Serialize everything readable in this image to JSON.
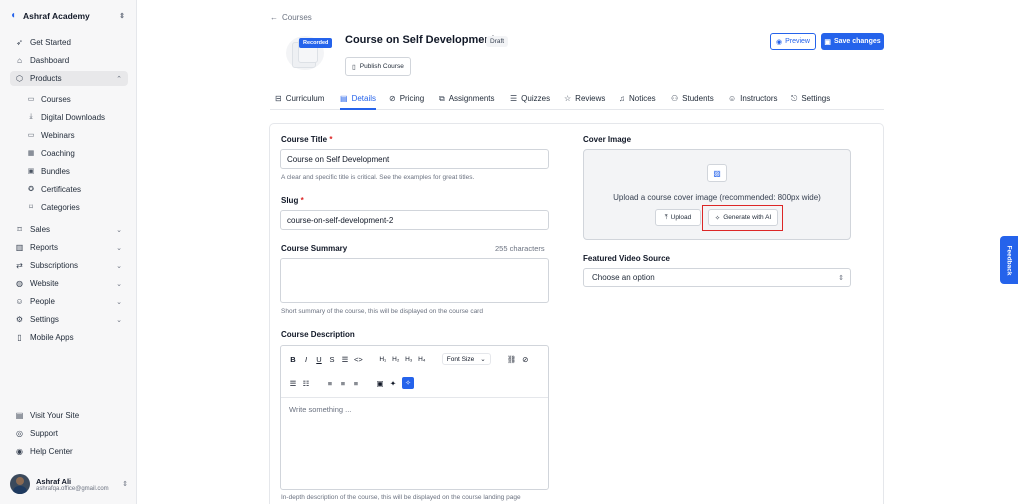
{
  "sidebar": {
    "org_name": "Ashraf Academy",
    "items": [
      {
        "label": "Get Started",
        "icon": "rocket-icon"
      },
      {
        "label": "Dashboard",
        "icon": "home-icon"
      },
      {
        "label": "Products",
        "icon": "box-icon"
      },
      {
        "label": "Sales",
        "icon": "tag-icon"
      },
      {
        "label": "Reports",
        "icon": "chart-icon"
      },
      {
        "label": "Subscriptions",
        "icon": "repeat-icon"
      },
      {
        "label": "Website",
        "icon": "globe-icon"
      },
      {
        "label": "People",
        "icon": "user-icon"
      },
      {
        "label": "Settings",
        "icon": "gear-icon"
      },
      {
        "label": "Mobile Apps",
        "icon": "phone-icon"
      }
    ],
    "product_subitems": [
      {
        "label": "Courses"
      },
      {
        "label": "Digital Downloads"
      },
      {
        "label": "Webinars"
      },
      {
        "label": "Coaching"
      },
      {
        "label": "Bundles"
      },
      {
        "label": "Certificates"
      },
      {
        "label": "Categories"
      }
    ],
    "footer_items": [
      {
        "label": "Visit Your Site"
      },
      {
        "label": "Support"
      },
      {
        "label": "Help Center"
      }
    ],
    "user": {
      "name": "Ashraf Ali",
      "email": "ashrafqa.office@gmail.com"
    }
  },
  "header": {
    "back_label": "Courses",
    "recorded_badge": "Recorded",
    "course_title": "Course on Self Development",
    "status": "Draft",
    "publish_label": "Publish Course",
    "preview_label": "Preview",
    "save_label": "Save changes"
  },
  "tabs": [
    {
      "label": "Curriculum"
    },
    {
      "label": "Details"
    },
    {
      "label": "Pricing"
    },
    {
      "label": "Assignments"
    },
    {
      "label": "Quizzes"
    },
    {
      "label": "Reviews"
    },
    {
      "label": "Notices"
    },
    {
      "label": "Students"
    },
    {
      "label": "Instructors"
    },
    {
      "label": "Settings"
    }
  ],
  "form": {
    "title_label": "Course Title",
    "title_value": "Course on Self Development",
    "title_help": "A clear and specific title is critical. See the examples for great titles.",
    "slug_label": "Slug",
    "slug_value": "course-on-self-development-2",
    "summary_label": "Course Summary",
    "summary_count": "255 characters",
    "summary_help": "Short summary of the course, this will be displayed on the course card",
    "description_label": "Course Description",
    "font_size_label": "Font Size",
    "description_placeholder": "Write something ...",
    "description_help": "In-depth description of the course, this will be displayed on the course landing page"
  },
  "cover": {
    "label": "Cover Image",
    "upload_text": "Upload a course cover image (recommended: 800px wide)",
    "upload_label": "Upload",
    "generate_label": "Generate with AI"
  },
  "video": {
    "label": "Featured Video Source",
    "selected": "Choose an option"
  },
  "feedback_label": "Feedback",
  "colors": {
    "accent": "#2563eb",
    "highlight": "#dc2626"
  }
}
